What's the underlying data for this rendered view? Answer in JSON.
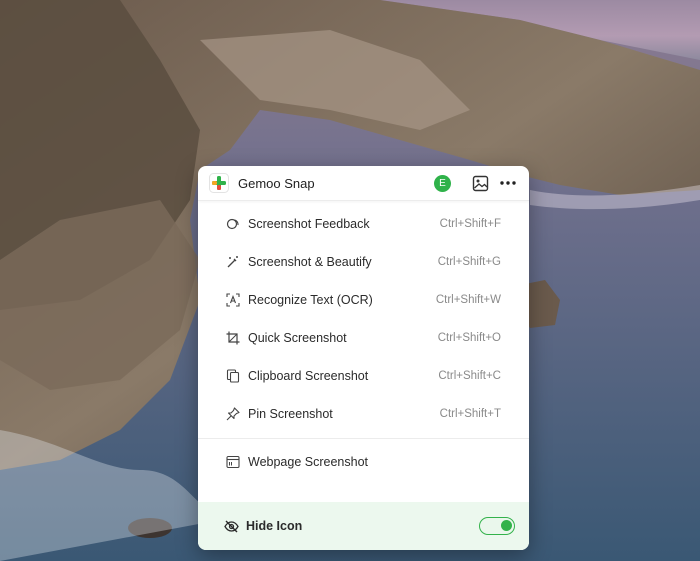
{
  "app": {
    "title": "Gemoo Snap",
    "avatar_letter": "E",
    "brand_color": "#2fb24a"
  },
  "header_icons": [
    "image-icon",
    "more-icon"
  ],
  "menu": {
    "items": [
      {
        "label": "Screenshot Feedback",
        "shortcut": "Ctrl+Shift+F",
        "icon": "feedback-icon"
      },
      {
        "label": "Screenshot & Beautify",
        "shortcut": "Ctrl+Shift+G",
        "icon": "magic-wand-icon"
      },
      {
        "label": "Recognize Text (OCR)",
        "shortcut": "Ctrl+Shift+W",
        "icon": "ocr-icon"
      },
      {
        "label": "Quick Screenshot",
        "shortcut": "Ctrl+Shift+O",
        "icon": "crop-icon"
      },
      {
        "label": "Clipboard Screenshot",
        "shortcut": "Ctrl+Shift+C",
        "icon": "clipboard-icon"
      },
      {
        "label": "Pin Screenshot",
        "shortcut": "Ctrl+Shift+T",
        "icon": "pin-icon"
      }
    ],
    "extra": {
      "label": "Webpage Screenshot",
      "icon": "webpage-icon"
    }
  },
  "footer": {
    "label": "Hide Icon",
    "icon": "eye-off-icon",
    "toggle_on": true
  }
}
